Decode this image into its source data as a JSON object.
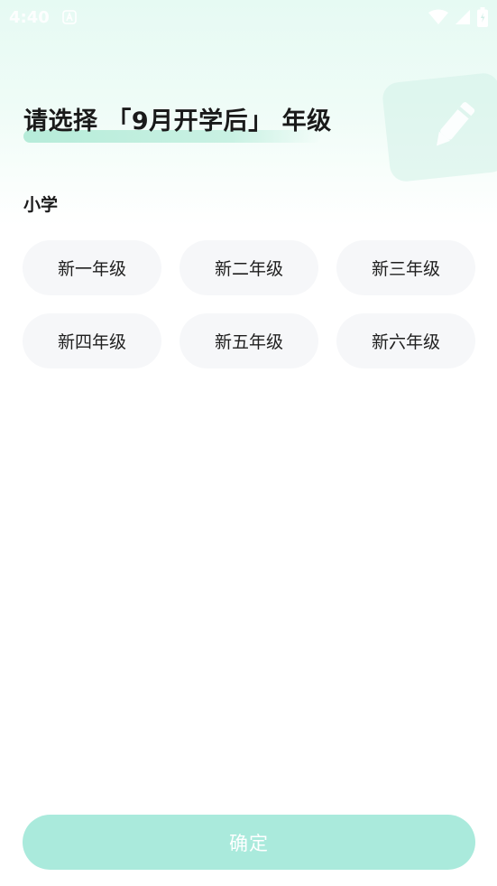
{
  "status_bar": {
    "time": "4:40",
    "icons": [
      "notification-a-icon",
      "wifi-icon",
      "signal-icon",
      "battery-icon"
    ]
  },
  "header": {
    "title": "请选择 「9月开学后」 年级",
    "decoration_icon": "pencil-note-icon"
  },
  "section": {
    "label": "小学",
    "grades": [
      "新一年级",
      "新二年级",
      "新三年级",
      "新四年级",
      "新五年级",
      "新六年级"
    ]
  },
  "footer": {
    "confirm_label": "确定"
  },
  "colors": {
    "accent": "#aaeadc",
    "title_highlight": "#b6ecd9",
    "option_bg": "#f6f7f9",
    "text": "#1a1a1a"
  }
}
